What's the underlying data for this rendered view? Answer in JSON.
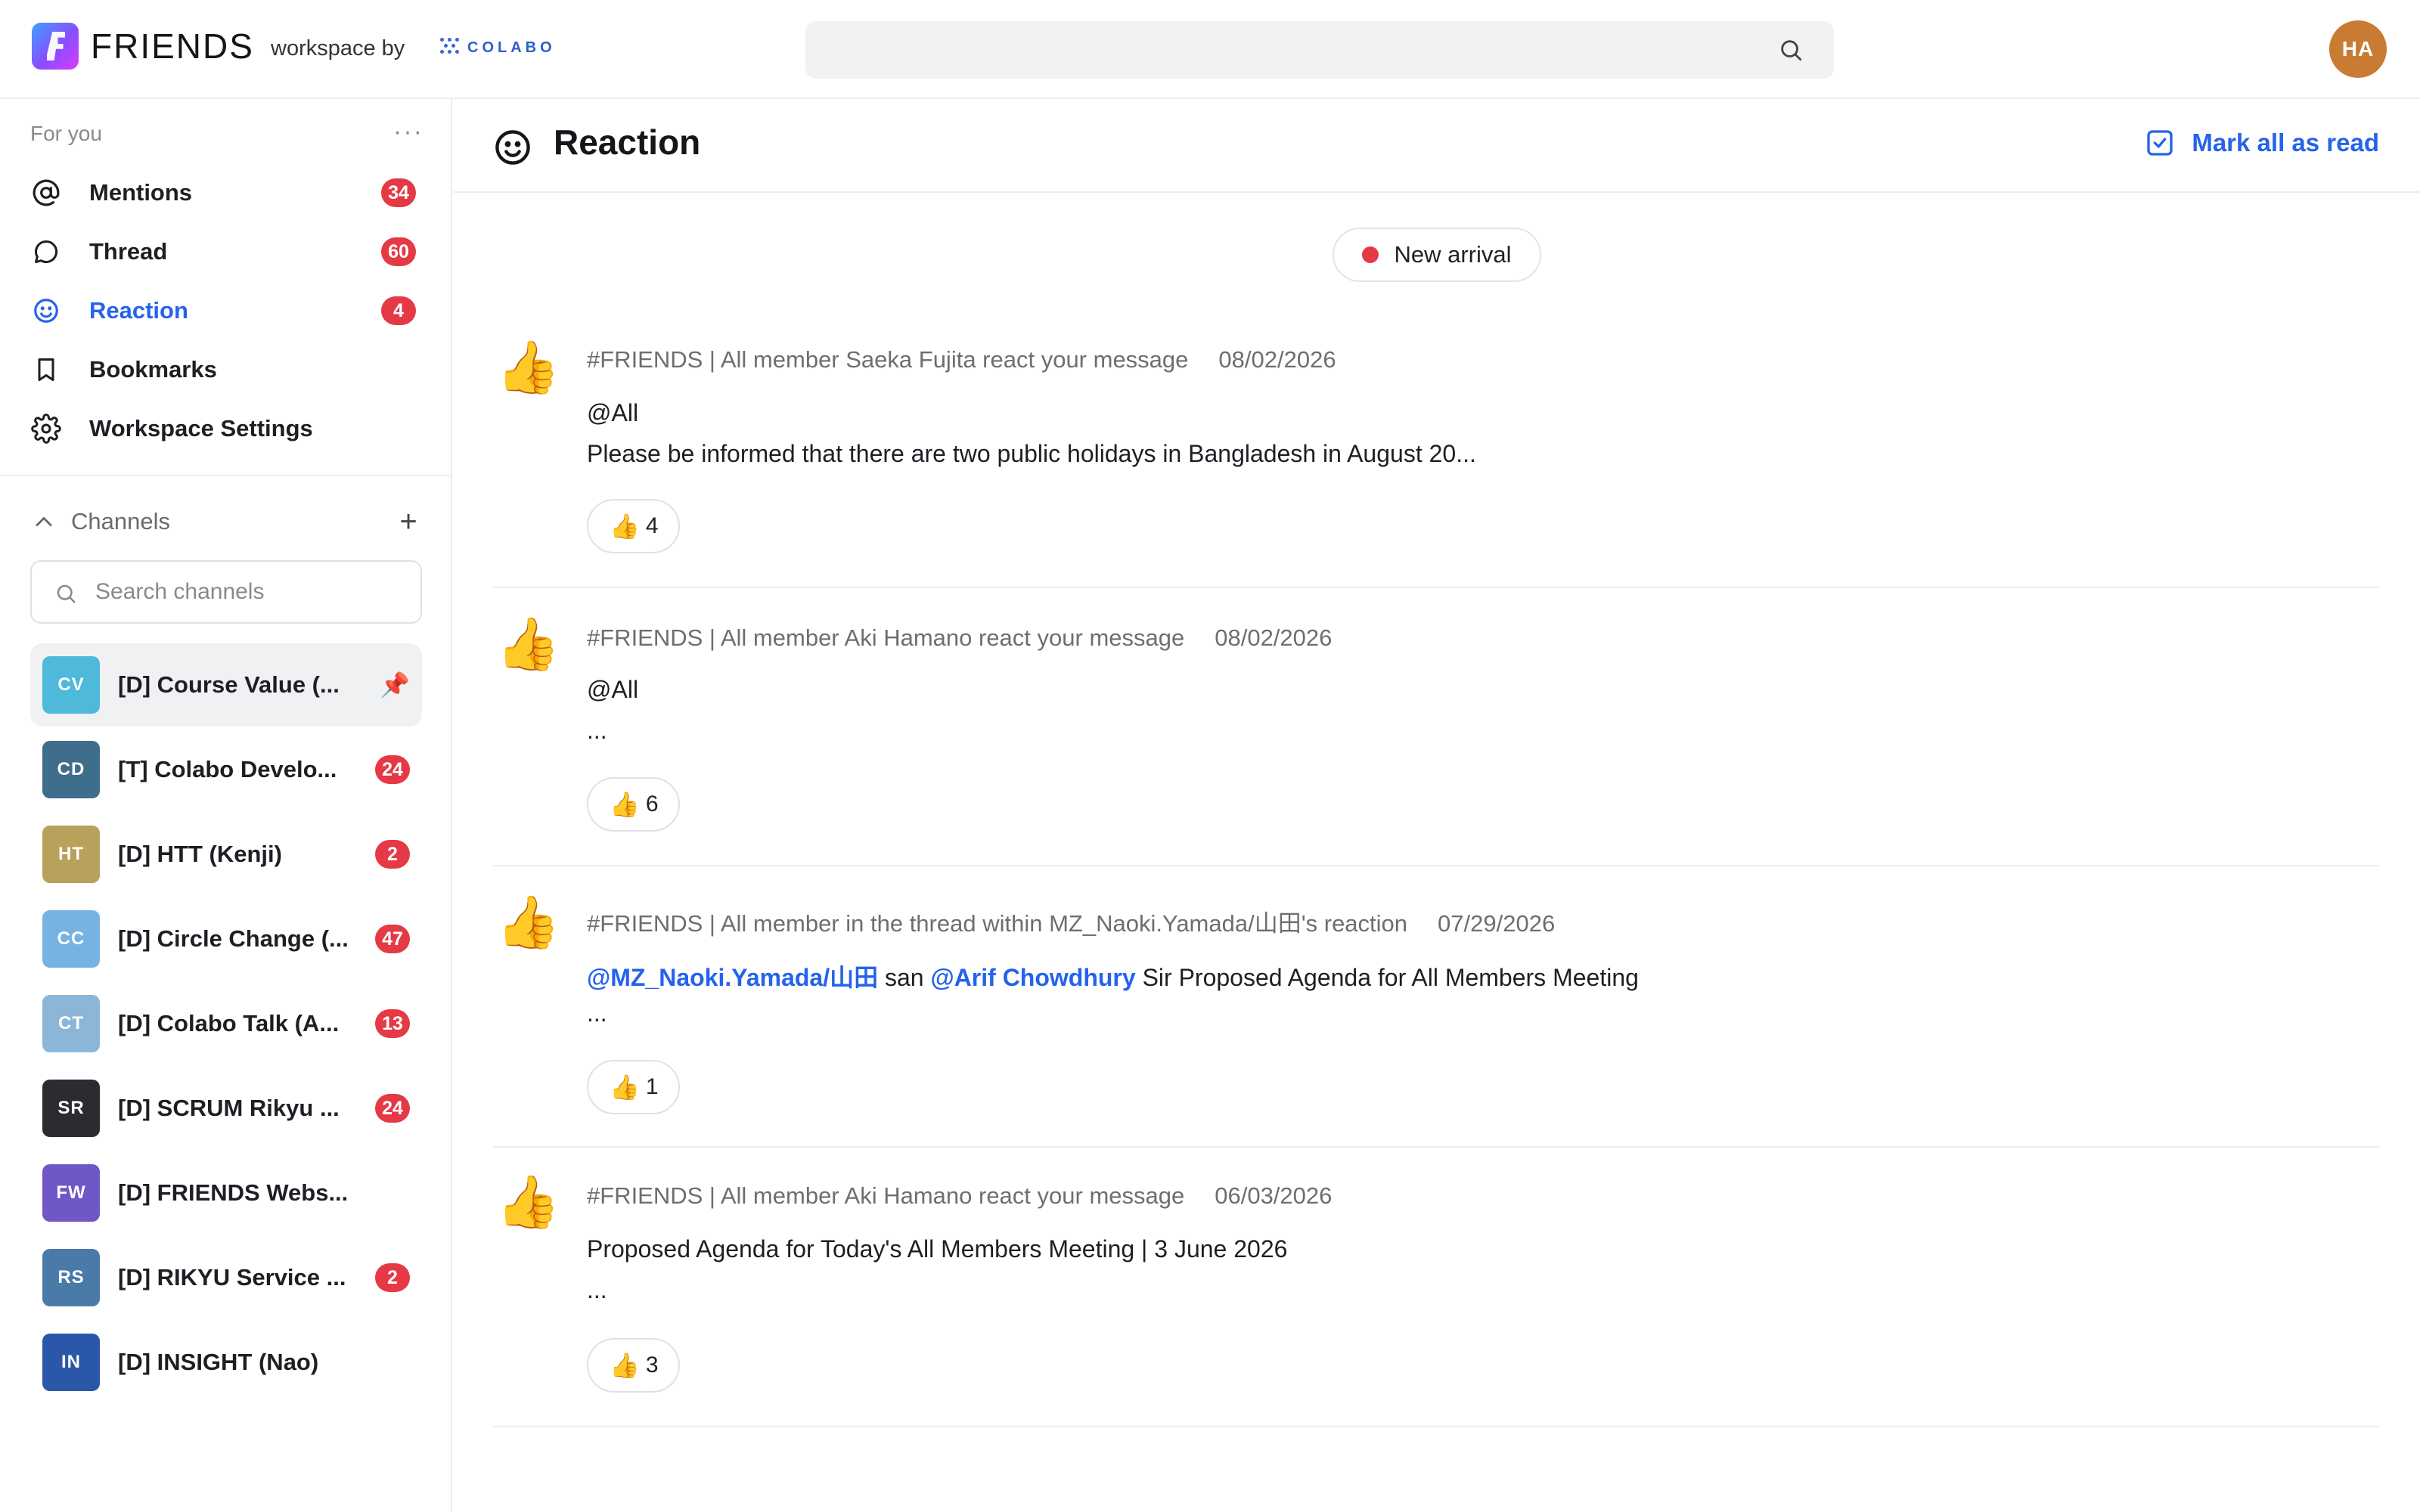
{
  "app": {
    "brand": "FRIENDS",
    "workspace_by": "workspace by",
    "partner": "COLABO"
  },
  "search": {
    "placeholder": "",
    "value": ""
  },
  "user": {
    "initials": "HA",
    "avatar_color": "#c97b33"
  },
  "sidebar": {
    "section_title": "For you",
    "more": "···",
    "items": [
      {
        "label": "Mentions",
        "badge": "34",
        "icon": "at-icon"
      },
      {
        "label": "Thread",
        "badge": "60",
        "icon": "chat-bubble-icon"
      },
      {
        "label": "Reaction",
        "badge": "4",
        "icon": "smiley-icon",
        "active": true
      },
      {
        "label": "Bookmarks",
        "badge": "",
        "icon": "bookmark-icon"
      },
      {
        "label": "Workspace Settings",
        "badge": "",
        "icon": "gear-icon"
      }
    ],
    "channels_title": "Channels",
    "channels_search_placeholder": "Search channels",
    "channels": [
      {
        "initials": "CV",
        "name": "[D] Course Value (...",
        "badge": "",
        "pinned": true,
        "color": "#4fb9db",
        "selected": true
      },
      {
        "initials": "CD",
        "name": "[T] Colabo Develo...",
        "badge": "24",
        "color": "#3f6d8c"
      },
      {
        "initials": "HT",
        "name": "[D] HTT (Kenji)",
        "badge": "2",
        "color": "#b8a15a"
      },
      {
        "initials": "CC",
        "name": "[D] Circle Change (...",
        "badge": "47",
        "color": "#77b3e2"
      },
      {
        "initials": "CT",
        "name": "[D] Colabo Talk (A...",
        "badge": "13",
        "color": "#8bb6d8"
      },
      {
        "initials": "SR",
        "name": "[D] SCRUM Rikyu ...",
        "badge": "24",
        "color": "#2b2c30"
      },
      {
        "initials": "FW",
        "name": "[D] FRIENDS Webs...",
        "badge": "",
        "color": "#6f57c7"
      },
      {
        "initials": "RS",
        "name": "[D] RIKYU Service ...",
        "badge": "2",
        "color": "#4a7aa8"
      },
      {
        "initials": "IN",
        "name": "[D] INSIGHT (Nao)",
        "badge": "",
        "color": "#2b57a8"
      }
    ]
  },
  "main": {
    "title": "Reaction",
    "mark_all_read": "Mark all as read",
    "new_arrival": "New arrival",
    "reactions": [
      {
        "meta": "#FRIENDS | All member Saeka Fujita react your message",
        "date": "08/02/2026",
        "line1": "@All",
        "line2": "Please be informed that there are two public holidays in Bangladesh in August 20...",
        "emoji": "👍",
        "count": "4"
      },
      {
        "meta": "#FRIENDS | All member Aki Hamano react your message",
        "date": "08/02/2026",
        "line1": "@All",
        "line2": "...",
        "emoji": "👍",
        "count": "6"
      },
      {
        "meta": "#FRIENDS | All member in the thread within MZ_Naoki.Yamada/山田's reaction",
        "date": "07/29/2026",
        "mention1": "@MZ_Naoki.Yamada/山田",
        "mid_text": " san ",
        "mention2": "@Arif Chowdhury",
        "tail_text": " Sir Proposed Agenda for All Members Meeting",
        "line2": "...",
        "emoji": "👍",
        "count": "1"
      },
      {
        "meta": "#FRIENDS | All member Aki Hamano react your message",
        "date": "06/03/2026",
        "line1": "Proposed Agenda for Today's All Members Meeting | 3 June 2026",
        "line2": "...",
        "emoji": "👍",
        "count": "3"
      }
    ]
  },
  "colors": {
    "accent": "#2563eb",
    "badge": "#e53945",
    "divider": "#ececec"
  }
}
